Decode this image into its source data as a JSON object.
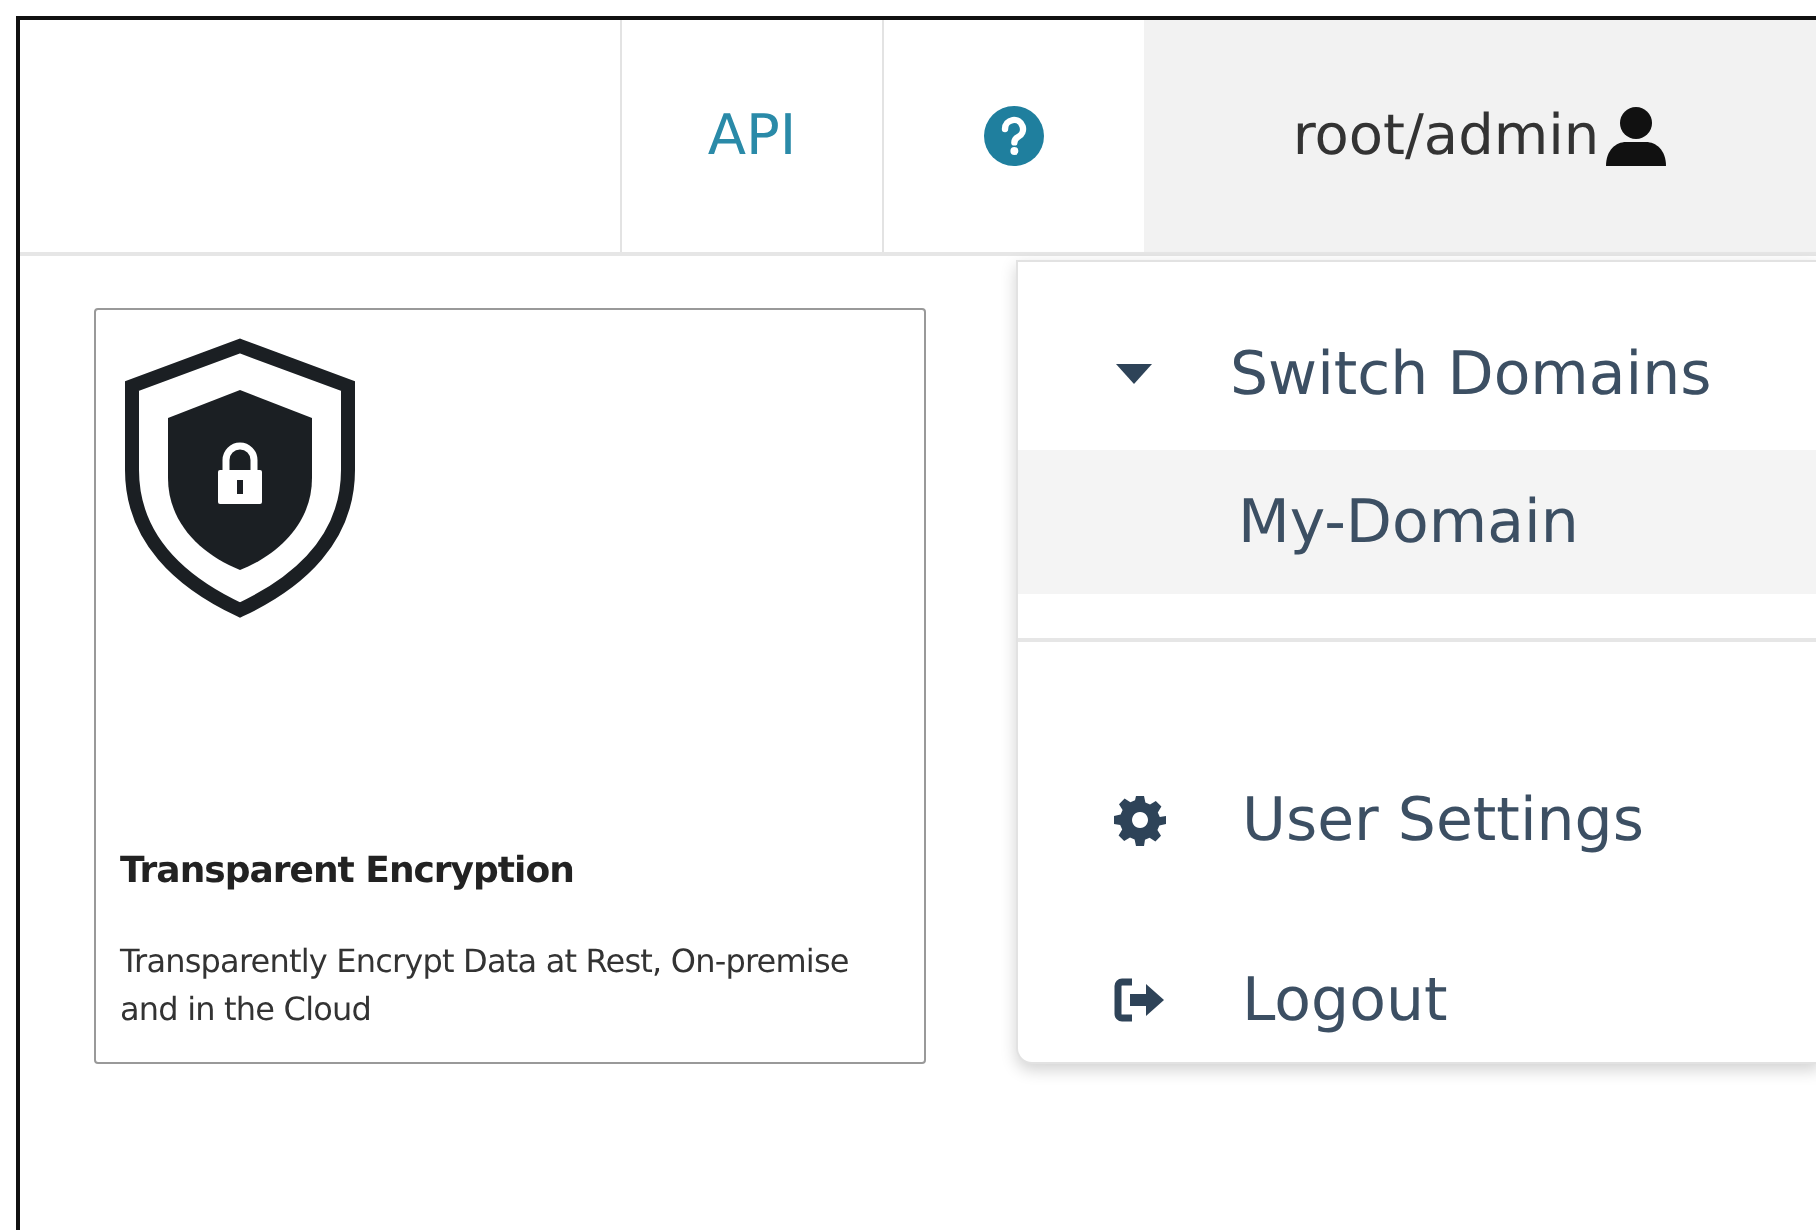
{
  "topbar": {
    "api_link": "API",
    "user": "root/admin"
  },
  "card": {
    "title": "Transparent Encryption",
    "description": "Transparently Encrypt Data at Rest, On-premise and in the Cloud"
  },
  "user_menu": {
    "switch_domains": {
      "label": "Switch Domains",
      "expanded": true,
      "domains": [
        {
          "label": "My-Domain",
          "selected": true
        }
      ]
    },
    "actions": [
      {
        "label": "User Settings"
      },
      {
        "label": "Logout"
      }
    ]
  }
}
